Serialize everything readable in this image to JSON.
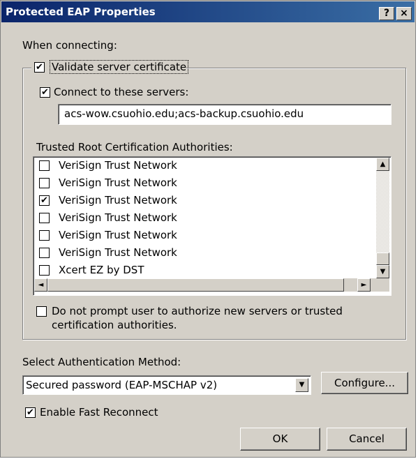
{
  "window": {
    "title": "Protected EAP Properties",
    "help_glyph": "?",
    "close_glyph": "×"
  },
  "when_connecting": "When connecting:",
  "validate": {
    "label": "Validate server certificate",
    "checked": true
  },
  "connect": {
    "label": "Connect to these servers:",
    "checked": true,
    "value": "acs-wow.csuohio.edu;acs-backup.csuohio.edu"
  },
  "trusted_label": "Trusted Root Certification Authorities:",
  "authorities": [
    {
      "name": "VeriSign Trust Network",
      "checked": false
    },
    {
      "name": "VeriSign Trust Network",
      "checked": false
    },
    {
      "name": "VeriSign Trust Network",
      "checked": true
    },
    {
      "name": "VeriSign Trust Network",
      "checked": false
    },
    {
      "name": "VeriSign Trust Network",
      "checked": false
    },
    {
      "name": "VeriSign Trust Network",
      "checked": false
    },
    {
      "name": "Xcert EZ by DST",
      "checked": false
    }
  ],
  "scroll_glyphs": {
    "up": "▲",
    "down": "▼",
    "left": "◄",
    "right": "►",
    "dropdown": "▼"
  },
  "do_not_prompt": {
    "line1": "Do not prompt user to authorize new servers or trusted",
    "line2": "certification authorities.",
    "checked": false
  },
  "auth_method": {
    "label": "Select Authentication Method:",
    "selected": "Secured password (EAP-MSCHAP v2)",
    "configure_label": "Configure..."
  },
  "fast_reconnect": {
    "label": "Enable Fast Reconnect",
    "checked": true
  },
  "buttons": {
    "ok": "OK",
    "cancel": "Cancel"
  }
}
